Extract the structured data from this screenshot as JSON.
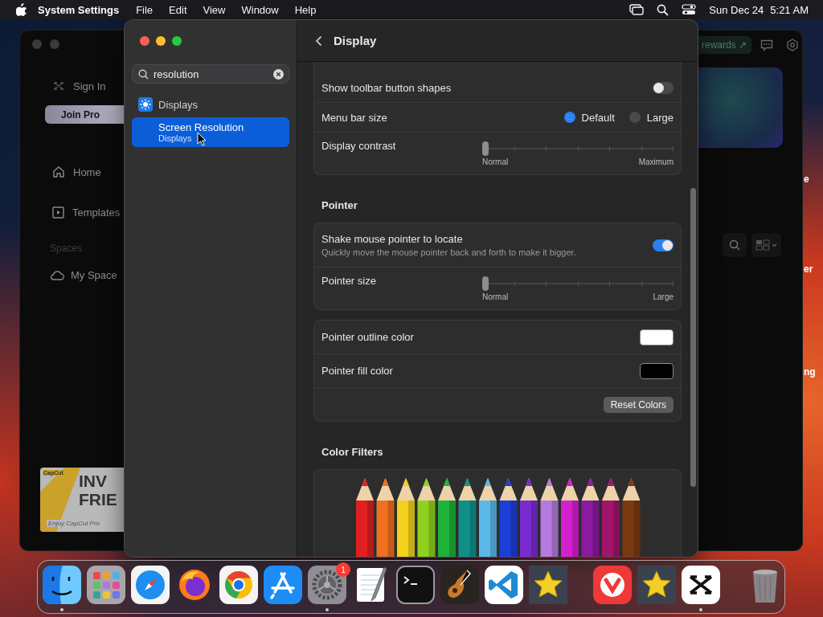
{
  "menu_bar": {
    "app_name": "System Settings",
    "menus": [
      "File",
      "Edit",
      "View",
      "Window",
      "Help"
    ],
    "date": "Sun Dec 24",
    "time": "5:21 AM"
  },
  "background_window": {
    "sign_in": "Sign In",
    "join_button": "Join Pro",
    "nav": [
      {
        "label": "Home",
        "kind": "home"
      },
      {
        "label": "Templates",
        "kind": "templates"
      }
    ],
    "spaces_heading": "Spaces",
    "space_item": "My Space",
    "banner": {
      "logo": "CapCut",
      "headline": [
        "INV",
        "FRIE"
      ],
      "tagline": "Enjoy CapCut Pro"
    },
    "rewards_button": "rewards ↗"
  },
  "desktop_labels": [
    "e",
    "er",
    "ng"
  ],
  "settings": {
    "search": {
      "value": "resolution"
    },
    "results": [
      {
        "kind": "section",
        "label": "Displays",
        "selected": false
      },
      {
        "kind": "result",
        "label": "Screen Resolution",
        "subtitle": "Displays",
        "selected": true
      }
    ],
    "title": "Display",
    "groups": [
      {
        "kind": "card",
        "rows": [
          {
            "kind": "toggle",
            "label": "Show toolbar button shapes",
            "on": false
          },
          {
            "kind": "radio",
            "label": "Menu bar size",
            "options": [
              {
                "label": "Default",
                "selected": true
              },
              {
                "label": "Large",
                "selected": false
              }
            ]
          },
          {
            "kind": "slider",
            "label": "Display contrast",
            "level": 0,
            "min_label": "Normal",
            "max_label": "Maximum"
          }
        ]
      },
      {
        "kind": "heading",
        "text": "Pointer"
      },
      {
        "kind": "card",
        "rows": [
          {
            "kind": "toggle",
            "label": "Shake mouse pointer to locate",
            "description": "Quickly move the mouse pointer back and forth to make it bigger.",
            "on": true
          },
          {
            "kind": "slider",
            "label": "Pointer size",
            "level": 0,
            "min_label": "Normal",
            "max_label": "Large"
          }
        ]
      },
      {
        "kind": "card",
        "rows": [
          {
            "kind": "color",
            "label": "Pointer outline color",
            "color": "#ffffff"
          },
          {
            "kind": "color",
            "label": "Pointer fill color",
            "color": "#000000"
          },
          {
            "kind": "button",
            "label": "Reset Colors"
          }
        ]
      },
      {
        "kind": "heading",
        "text": "Color Filters"
      },
      {
        "kind": "card",
        "rows": [
          {
            "kind": "pencils"
          }
        ]
      }
    ]
  },
  "dock": {
    "items": [
      {
        "kind": "finder",
        "running": true
      },
      {
        "kind": "launchpad",
        "running": false
      },
      {
        "kind": "safari",
        "running": false
      },
      {
        "kind": "firefox",
        "running": false
      },
      {
        "kind": "chrome",
        "running": false
      },
      {
        "kind": "appstore",
        "running": false
      },
      {
        "kind": "settings",
        "running": true,
        "badge": "1"
      },
      {
        "kind": "textedit",
        "running": false
      },
      {
        "kind": "terminal",
        "running": false
      },
      {
        "kind": "garageband",
        "running": false
      },
      {
        "kind": "vscode",
        "running": false
      },
      {
        "kind": "star",
        "running": false
      },
      {
        "kind": "separator"
      },
      {
        "kind": "vivaldi",
        "running": false
      },
      {
        "kind": "star",
        "running": false
      },
      {
        "kind": "capcut",
        "running": true
      },
      {
        "kind": "separator"
      },
      {
        "kind": "trash",
        "running": false
      }
    ]
  }
}
